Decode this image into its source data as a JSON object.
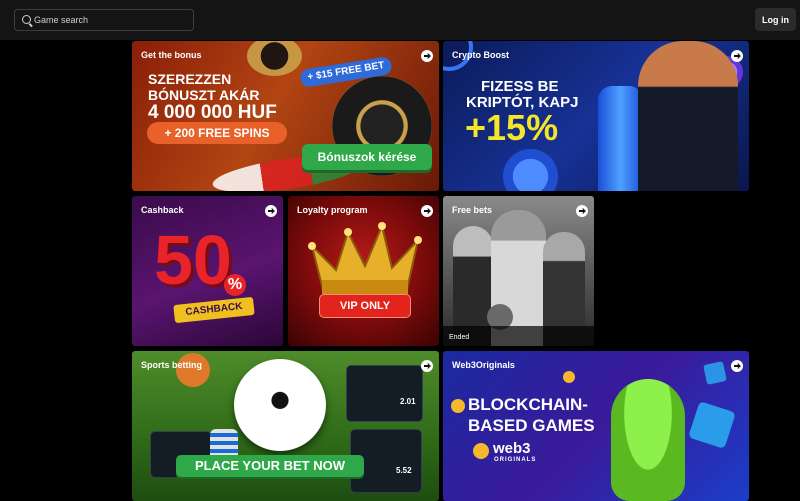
{
  "header": {
    "search_placeholder": "Game search",
    "login_label": "Log in"
  },
  "cards": {
    "bonus": {
      "title": "Get the bonus",
      "line1": "SZEREZZEN",
      "line2": "BÓNUSZT AKÁR",
      "amount": "4 000 000 HUF",
      "spins": "+ 200 FREE SPINS",
      "free_bet": "+ $15 FREE BET",
      "button": "Bónuszok kérése"
    },
    "crypto": {
      "title": "Crypto Boost",
      "line1": "FIZESS BE",
      "line2": "KRIPTÓT, KAPJ",
      "boost": "+15%"
    },
    "cashback": {
      "title": "Cashback",
      "number": "50",
      "percent": "%",
      "ribbon": "CASHBACK"
    },
    "loyalty": {
      "title": "Loyalty program",
      "badge": "VIP ONLY"
    },
    "freebets": {
      "title": "Free bets",
      "status": "Ended"
    },
    "sports": {
      "title": "Sports betting",
      "banner": "PLACE YOUR BET NOW",
      "odds1": "2.01",
      "odds2": "5.52"
    },
    "web3": {
      "title": "Web3Originals",
      "line1": "BLOCKCHAIN-",
      "line2": "BASED GAMES",
      "logo": "web3",
      "logo_sub": "ORIGINALS"
    }
  },
  "colors": {
    "page_bg": "#000000",
    "header_bg": "#141414",
    "button_green": "#2fa84a",
    "boost_yellow": "#f5e62a",
    "vip_red": "#e2241c"
  }
}
